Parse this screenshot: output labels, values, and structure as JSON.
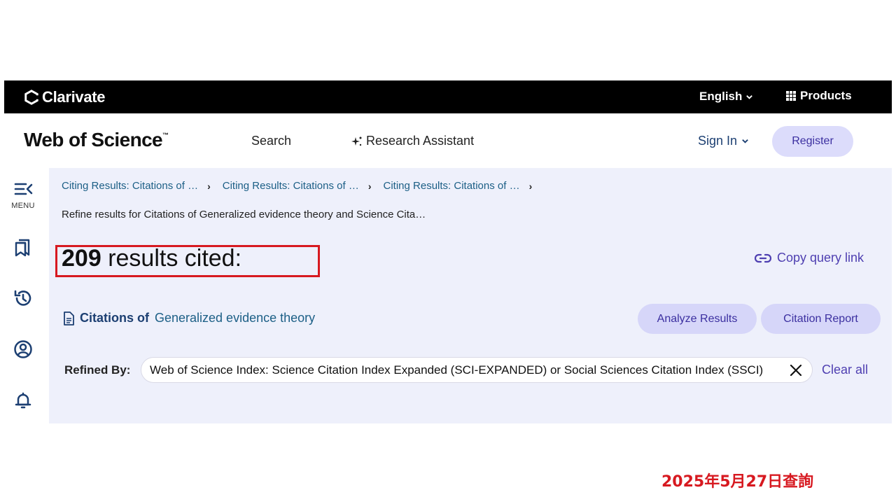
{
  "topbar": {
    "brand": "Clarivate",
    "language": "English",
    "products": "Products"
  },
  "header": {
    "logo": "Web of Science",
    "logo_tm": "™",
    "nav_search": "Search",
    "nav_research_assistant": "Research Assistant",
    "sign_in": "Sign In",
    "register": "Register"
  },
  "sidebar": {
    "menu_label": "MENU",
    "icons": [
      "menu-collapse-icon",
      "bookmark-icon",
      "history-icon",
      "account-icon",
      "bell-icon"
    ]
  },
  "breadcrumbs": [
    "Citing Results: Citations of …",
    "Citing Results: Citations of …",
    "Citing Results: Citations of …"
  ],
  "refine_text": "Refine results for Citations of Generalized evidence theory and Science Cita…",
  "results": {
    "count": "209",
    "suffix": "results cited:"
  },
  "copy_query_link": "Copy query link",
  "citations": {
    "prefix": "Citations of",
    "title": "Generalized evidence theory"
  },
  "buttons": {
    "analyze": "Analyze Results",
    "citation_report": "Citation Report"
  },
  "refined_by": {
    "label": "Refined By:",
    "filter": "Web of Science Index: Science Citation Index Expanded (SCI-EXPANDED) or Social Sciences Citation Index (SSCI)",
    "clear_all": "Clear all"
  },
  "annotation": {
    "date_note": "2025年5月27日查詢",
    "highlight_color": "#d71920"
  }
}
